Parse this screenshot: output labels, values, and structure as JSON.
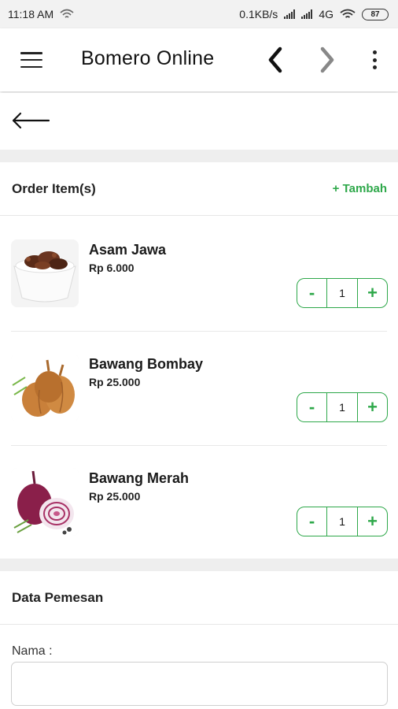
{
  "status_bar": {
    "time": "11:18 AM",
    "net_speed": "0.1KB/s",
    "network": "4G",
    "battery": "87"
  },
  "app_bar": {
    "title": "Bomero Online"
  },
  "order": {
    "title": "Order Item(s)",
    "add_label": "+ Tambah",
    "items": [
      {
        "name": "Asam Jawa",
        "price": "Rp 6.000",
        "qty": "1",
        "image": "tamarind"
      },
      {
        "name": "Bawang Bombay",
        "price": "Rp 25.000",
        "qty": "1",
        "image": "onion"
      },
      {
        "name": "Bawang Merah",
        "price": "Rp 25.000",
        "qty": "1",
        "image": "red-onion"
      }
    ],
    "minus_label": "-",
    "plus_label": "+"
  },
  "buyer": {
    "title": "Data Pemesan",
    "name_label": "Nama :",
    "name_value": ""
  },
  "colors": {
    "accent": "#2ea84a",
    "divider": "#e6e6e6",
    "gap": "#eeeeee"
  }
}
